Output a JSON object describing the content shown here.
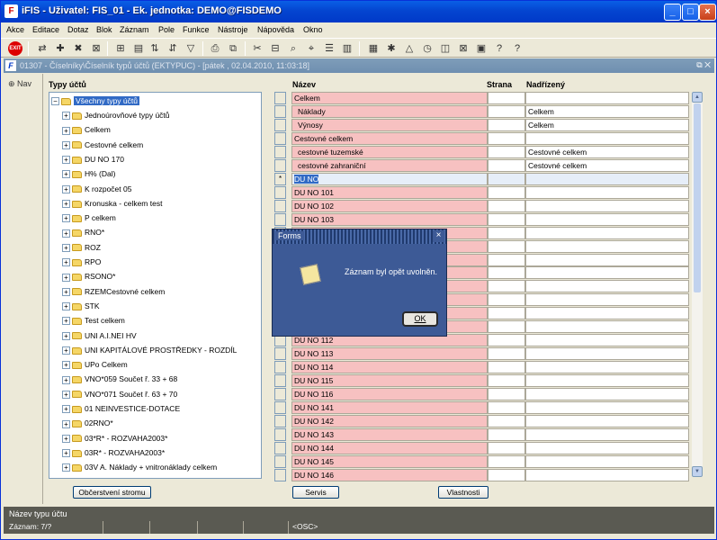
{
  "window": {
    "title": "iFIS - Uživatel: FIS_01 - Ek. jednotka: DEMO@FISDEMO",
    "app_icon_text": "F"
  },
  "menu": [
    "Akce",
    "Editace",
    "Dotaz",
    "Blok",
    "Záznam",
    "Pole",
    "Funkce",
    "Nástroje",
    "Nápověda",
    "Okno"
  ],
  "inner_window": {
    "title": "01307 - Číselníky\\Číselník typů účtů (EKTYPUC) - [pátek , 02.04.2010, 11:03:18]",
    "icon_text": "F"
  },
  "nav": {
    "label": "Nav"
  },
  "tree": {
    "heading": "Typy účtů",
    "root": "Všechny typy účtů",
    "items": [
      "Jednoúrovňové typy účtů",
      "Celkem",
      "Cestovné celkem",
      "DU NO 170",
      "H% (Dal)",
      "K rozpočet 05",
      "Kronuska - celkem test",
      "P celkem",
      "RNO*",
      "ROZ",
      "RPO",
      "RSONO*",
      "RZEMCestovné celkem",
      "STK",
      "Test celkem",
      "UNI A.I.NEI HV",
      "UNI KAPITÁLOVÉ PROSTŘEDKY - ROZDÍL",
      "UPo Celkem",
      "VNO*059 Součet ř. 33 + 68",
      "VNO*071 Součet ř. 63 + 70",
      "01 NEINVESTICE-DOTACE",
      "02RNO*",
      "03*R* - ROZVAHA2003*",
      "03R* - ROZVAHA2003*",
      "03V A. Náklady + vnitronáklady celkem"
    ]
  },
  "grid": {
    "headers": {
      "name": "Název",
      "strana": "Strana",
      "parent": "Nadřízený"
    },
    "current_marker": "*",
    "rows": [
      {
        "name": "Celkem",
        "strana": "",
        "parent": ""
      },
      {
        "name": "Náklady",
        "strana": "",
        "parent": "Celkem"
      },
      {
        "name": "Výnosy",
        "strana": "",
        "parent": "Celkem"
      },
      {
        "name": "Cestovné celkem",
        "strana": "",
        "parent": ""
      },
      {
        "name": "cestovné tuzemské",
        "strana": "",
        "parent": "Cestovné celkem"
      },
      {
        "name": "cestovné zahraniční",
        "strana": "",
        "parent": "Cestovné celkem"
      },
      {
        "name": "DU NO",
        "strana": "",
        "parent": ""
      },
      {
        "name": "DU NO 101",
        "strana": "",
        "parent": ""
      },
      {
        "name": "DU NO 102",
        "strana": "",
        "parent": ""
      },
      {
        "name": "DU NO 103",
        "strana": "",
        "parent": ""
      },
      {
        "name": "",
        "strana": "",
        "parent": ""
      },
      {
        "name": "",
        "strana": "",
        "parent": ""
      },
      {
        "name": "",
        "strana": "",
        "parent": ""
      },
      {
        "name": "",
        "strana": "",
        "parent": ""
      },
      {
        "name": "",
        "strana": "",
        "parent": ""
      },
      {
        "name": "",
        "strana": "",
        "parent": ""
      },
      {
        "name": "",
        "strana": "",
        "parent": ""
      },
      {
        "name": "",
        "strana": "",
        "parent": ""
      },
      {
        "name": "DU NO 112",
        "strana": "",
        "parent": ""
      },
      {
        "name": "DU NO 113",
        "strana": "",
        "parent": ""
      },
      {
        "name": "DU NO 114",
        "strana": "",
        "parent": ""
      },
      {
        "name": "DU NO 115",
        "strana": "",
        "parent": ""
      },
      {
        "name": "DU NO 116",
        "strana": "",
        "parent": ""
      },
      {
        "name": "DU NO 141",
        "strana": "",
        "parent": ""
      },
      {
        "name": "DU NO 142",
        "strana": "",
        "parent": ""
      },
      {
        "name": "DU NO 143",
        "strana": "",
        "parent": ""
      },
      {
        "name": "DU NO 144",
        "strana": "",
        "parent": ""
      },
      {
        "name": "DU NO 145",
        "strana": "",
        "parent": ""
      },
      {
        "name": "DU NO 146",
        "strana": "",
        "parent": ""
      }
    ]
  },
  "buttons": {
    "refresh_tree": "Občerstvení stromu",
    "servis": "Servis",
    "vlastnosti": "Vlastnosti"
  },
  "dialog": {
    "title": "Forms",
    "message": "Záznam byl opět uvolněn.",
    "ok": "OK"
  },
  "status": {
    "field_name": "Název typu účtu",
    "record": "Záznam: 7/?",
    "osc": "<OSC>"
  },
  "colors": {
    "pink_cell": "#f7c1c1",
    "selection": "#316ac5",
    "title_blue": "#0039c8",
    "dialog_bg": "#3d5a96"
  }
}
